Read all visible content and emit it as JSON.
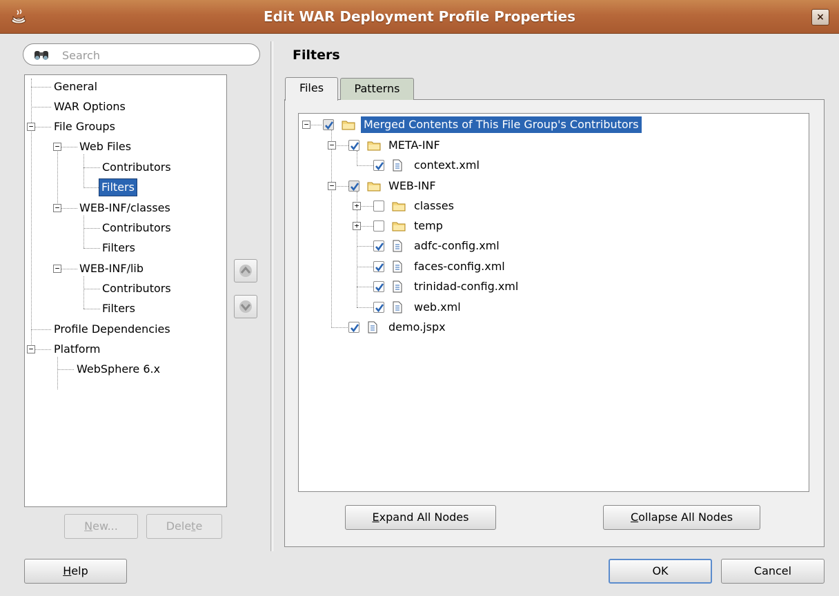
{
  "window": {
    "title": "Edit WAR Deployment Profile Properties",
    "close_glyph": "×"
  },
  "search": {
    "placeholder": "Search",
    "value": ""
  },
  "nav": {
    "items": [
      {
        "label": "General"
      },
      {
        "label": "WAR Options"
      },
      {
        "label": "File Groups"
      },
      {
        "label": "Web Files"
      },
      {
        "label": "Contributors"
      },
      {
        "label": "Filters",
        "selected": true
      },
      {
        "label": "WEB-INF/classes"
      },
      {
        "label": "Contributors"
      },
      {
        "label": "Filters"
      },
      {
        "label": "WEB-INF/lib"
      },
      {
        "label": "Contributors"
      },
      {
        "label": "Filters"
      },
      {
        "label": "Profile Dependencies"
      },
      {
        "label": "Platform"
      },
      {
        "label": "WebSphere 6.x"
      }
    ],
    "new_button": {
      "pre": "",
      "mnemonic": "N",
      "post": "ew..."
    },
    "delete_button": {
      "pre": "Dele",
      "mnemonic": "t",
      "post": "e"
    }
  },
  "section": {
    "title": "Filters"
  },
  "tabs": [
    {
      "label": "Files",
      "active": true
    },
    {
      "label": "Patterns",
      "active": false
    }
  ],
  "files_tree": {
    "nodes": [
      {
        "label": "Merged Contents of This File Group's Contributors",
        "icon": "folder-icon",
        "checked": "partial",
        "highlighted": true
      },
      {
        "label": "META-INF",
        "icon": "folder-icon",
        "checked": "checked"
      },
      {
        "label": "context.xml",
        "icon": "file-icon",
        "checked": "checked"
      },
      {
        "label": "WEB-INF",
        "icon": "folder-icon",
        "checked": "partial"
      },
      {
        "label": "classes",
        "icon": "folder-icon",
        "checked": "unchecked"
      },
      {
        "label": "temp",
        "icon": "folder-icon",
        "checked": "unchecked"
      },
      {
        "label": "adfc-config.xml",
        "icon": "file-icon",
        "checked": "checked"
      },
      {
        "label": "faces-config.xml",
        "icon": "file-icon",
        "checked": "checked"
      },
      {
        "label": "trinidad-config.xml",
        "icon": "file-icon",
        "checked": "checked"
      },
      {
        "label": "web.xml",
        "icon": "file-icon",
        "checked": "checked"
      },
      {
        "label": "demo.jspx",
        "icon": "file-icon",
        "checked": "checked"
      }
    ],
    "expand_button": {
      "pre": "",
      "mnemonic": "E",
      "post": "xpand All Nodes"
    },
    "collapse_button": {
      "pre": "",
      "mnemonic": "C",
      "post": "ollapse All Nodes"
    }
  },
  "footer": {
    "help_button": {
      "pre": "",
      "mnemonic": "H",
      "post": "elp"
    },
    "ok_button": "OK",
    "cancel_button": "Cancel"
  },
  "colors": {
    "title_bar": "#b7683a",
    "selection": "#2a65b3",
    "check": "#2a65b3"
  }
}
